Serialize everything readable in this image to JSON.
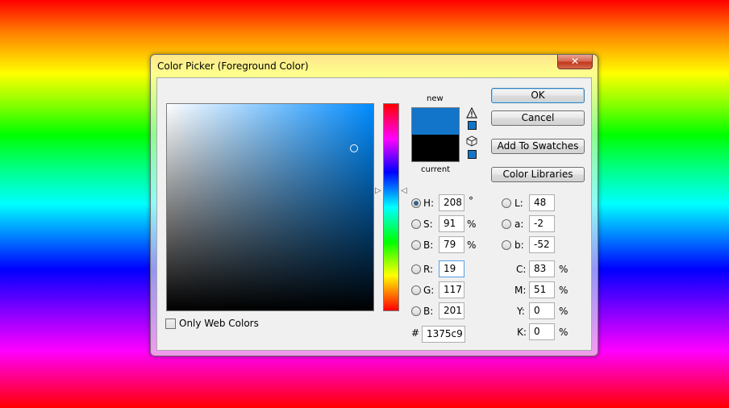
{
  "window": {
    "title": "Color Picker (Foreground Color)",
    "close_glyph": "✕"
  },
  "color": {
    "new_hex": "#1375c9",
    "current_hex": "#000000",
    "hue_hex": "#008cff"
  },
  "swatch": {
    "new_label": "new",
    "current_label": "current"
  },
  "buttons": {
    "ok": "OK",
    "cancel": "Cancel",
    "add_to_swatches": "Add To Swatches",
    "color_libraries": "Color Libraries"
  },
  "fields": {
    "H": {
      "label": "H:",
      "value": "208",
      "unit": "°"
    },
    "S": {
      "label": "S:",
      "value": "91",
      "unit": "%"
    },
    "Bv": {
      "label": "B:",
      "value": "79",
      "unit": "%"
    },
    "R": {
      "label": "R:",
      "value": "19"
    },
    "G": {
      "label": "G:",
      "value": "117"
    },
    "Bc": {
      "label": "B:",
      "value": "201"
    },
    "L": {
      "label": "L:",
      "value": "48"
    },
    "a": {
      "label": "a:",
      "value": "-2"
    },
    "b": {
      "label": "b:",
      "value": "-52"
    },
    "C": {
      "label": "C:",
      "value": "83",
      "unit": "%"
    },
    "M": {
      "label": "M:",
      "value": "51",
      "unit": "%"
    },
    "Y": {
      "label": "Y:",
      "value": "0",
      "unit": "%"
    },
    "K": {
      "label": "K:",
      "value": "0",
      "unit": "%"
    },
    "hex": {
      "label": "#",
      "value": "1375c9"
    }
  },
  "only_web_colors": {
    "label": "Only Web Colors",
    "checked": false
  },
  "selected_radio": "H"
}
